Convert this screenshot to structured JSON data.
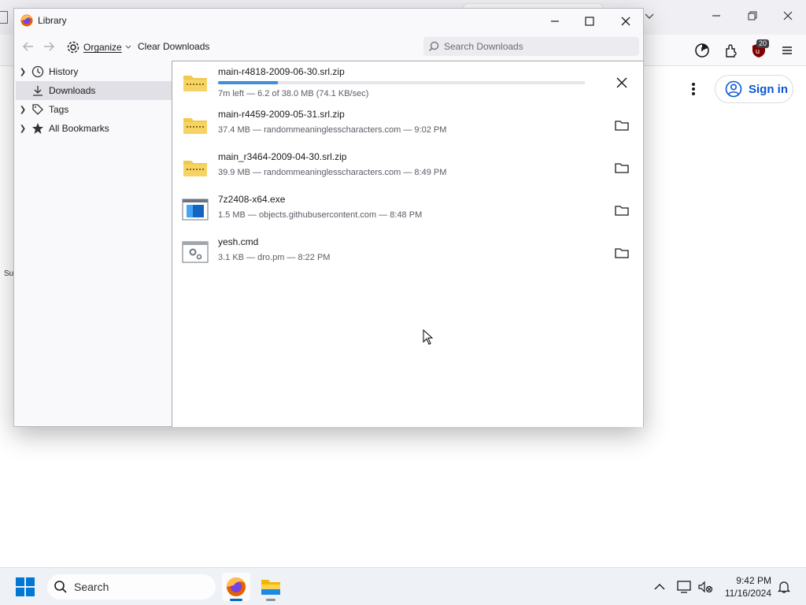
{
  "library": {
    "title": "Library",
    "toolbar": {
      "organize_label": "Organize",
      "clear_label": "Clear Downloads",
      "search_placeholder": "Search Downloads"
    },
    "sidebar": [
      {
        "label": "History",
        "icon": "clock-icon",
        "expandable": true,
        "selected": false
      },
      {
        "label": "Downloads",
        "icon": "download-icon",
        "expandable": false,
        "selected": true
      },
      {
        "label": "Tags",
        "icon": "tag-icon",
        "expandable": true,
        "selected": false
      },
      {
        "label": "All Bookmarks",
        "icon": "star-icon",
        "expandable": true,
        "selected": false
      }
    ],
    "downloads": [
      {
        "name": "main-r4818-2009-06-30.srl.zip",
        "status": "7m left — 6.2 of 38.0 MB (74.1 KB/sec)",
        "progress": 0.163,
        "icon": "zip-folder-icon",
        "action": "cancel"
      },
      {
        "name": "main-r4459-2009-05-31.srl.zip",
        "status": "37.4 MB — randommeaninglesscharacters.com — 9:02 PM",
        "icon": "zip-folder-icon",
        "action": "show-in-folder"
      },
      {
        "name": "main_r3464-2009-04-30.srl.zip",
        "status": "39.9 MB — randommeaninglesscharacters.com — 8:49 PM",
        "icon": "zip-folder-icon",
        "action": "show-in-folder"
      },
      {
        "name": "7z2408-x64.exe",
        "status": "1.5 MB — objects.githubusercontent.com — 8:48 PM",
        "icon": "exe-file-icon",
        "action": "show-in-folder"
      },
      {
        "name": "yesh.cmd",
        "status": "3.1 KB — dro.pm — 8:22 PM",
        "icon": "cmd-file-icon",
        "action": "show-in-folder"
      }
    ]
  },
  "browser": {
    "signin_label": "Sign in",
    "extension_badge": "20",
    "partial_text": "Su"
  },
  "taskbar": {
    "search_label": "Search",
    "time": "9:42 PM",
    "date": "11/16/2024"
  },
  "colors": {
    "accent": "#0b57d0",
    "progress": "#3d8fde",
    "selected_bg": "#e0e0e6"
  }
}
